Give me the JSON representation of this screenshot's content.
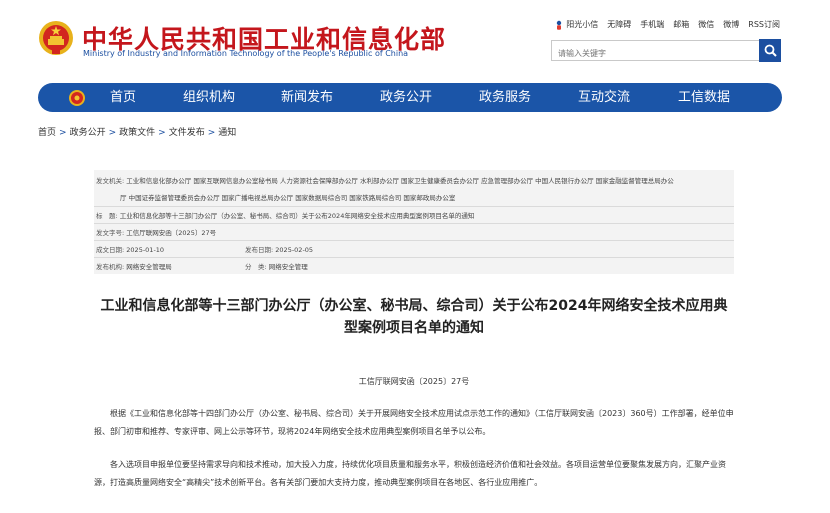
{
  "header": {
    "title": "中华人民共和国工业和信息化部",
    "subtitle": "Ministry of Industry and Information Technology of the People's Republic of China",
    "links": [
      "阳光小信",
      "无障碍",
      "手机端",
      "邮箱",
      "微信",
      "微博",
      "RSS订阅"
    ],
    "search_placeholder": "请输入关键字"
  },
  "nav": {
    "items": [
      "首页",
      "组织机构",
      "新闻发布",
      "政务公开",
      "政务服务",
      "互动交流",
      "工信数据"
    ]
  },
  "breadcrumb": [
    "首页",
    "政务公开",
    "政策文件",
    "文件发布",
    "通知"
  ],
  "meta": {
    "issuer_label": "发文机关:",
    "issuer_line1": "工业和信息化部办公厅 国家互联网信息办公室秘书局 人力资源社会保障部办公厅 水利部办公厅 国家卫生健康委员会办公厅 应急管理部办公厅 中国人民银行办公厅 国家金融监督管理总局办公",
    "issuer_line2": "厅 中国证券监督管理委员会办公厅 国家广播电视总局办公厅 国家数据局综合司 国家铁路局综合司 国家邮政局办公室",
    "title_label": "标　题:",
    "title_value": "工业和信息化部等十三部门办公厅（办公室、秘书局、综合司）关于公布2024年网络安全技术应用典型案例项目名单的通知",
    "docno_label": "发文字号:",
    "docno_value": "工信厅联网安函〔2025〕27号",
    "created_label": "成文日期:",
    "created_value": "2025-01-10",
    "published_label": "发布日期:",
    "published_value": "2025-02-05",
    "org_label": "发布机构:",
    "org_value": "网络安全管理局",
    "category_label": "分　类:",
    "category_value": "网络安全管理"
  },
  "article": {
    "title_line1": "工业和信息化部等十三部门办公厅（办公室、秘书局、综合司）关于公布2024年网络安全技术应用典",
    "title_line2": "型案例项目名单的通知",
    "doc_number": "工信厅联网安函〔2025〕27号",
    "paragraph1": "根据《工业和信息化部等十四部门办公厅（办公室、秘书局、综合司）关于开展网络安全技术应用试点示范工作的通知》（工信厅联网安函〔2023〕360号）工作部署，经单位申报、部门初审和推荐、专家评审、网上公示等环节，现将2024年网络安全技术应用典型案例项目名单予以公布。",
    "paragraph2": "各入选项目申报单位要坚持需求导向和技术推动，加大投入力度，持续优化项目质量和服务水平，积极创造经济价值和社会效益。各项目运营单位要聚焦发展方向，汇聚产业资源，打造高质量网络安全“高精尖”技术创新平台。各有关部门要加大支持力度，推动典型案例项目在各地区、各行业应用推广。"
  },
  "colors": {
    "brand_red": "#c4161c",
    "nav_blue": "#1b55a8",
    "link_blue": "#1c4fa0"
  }
}
